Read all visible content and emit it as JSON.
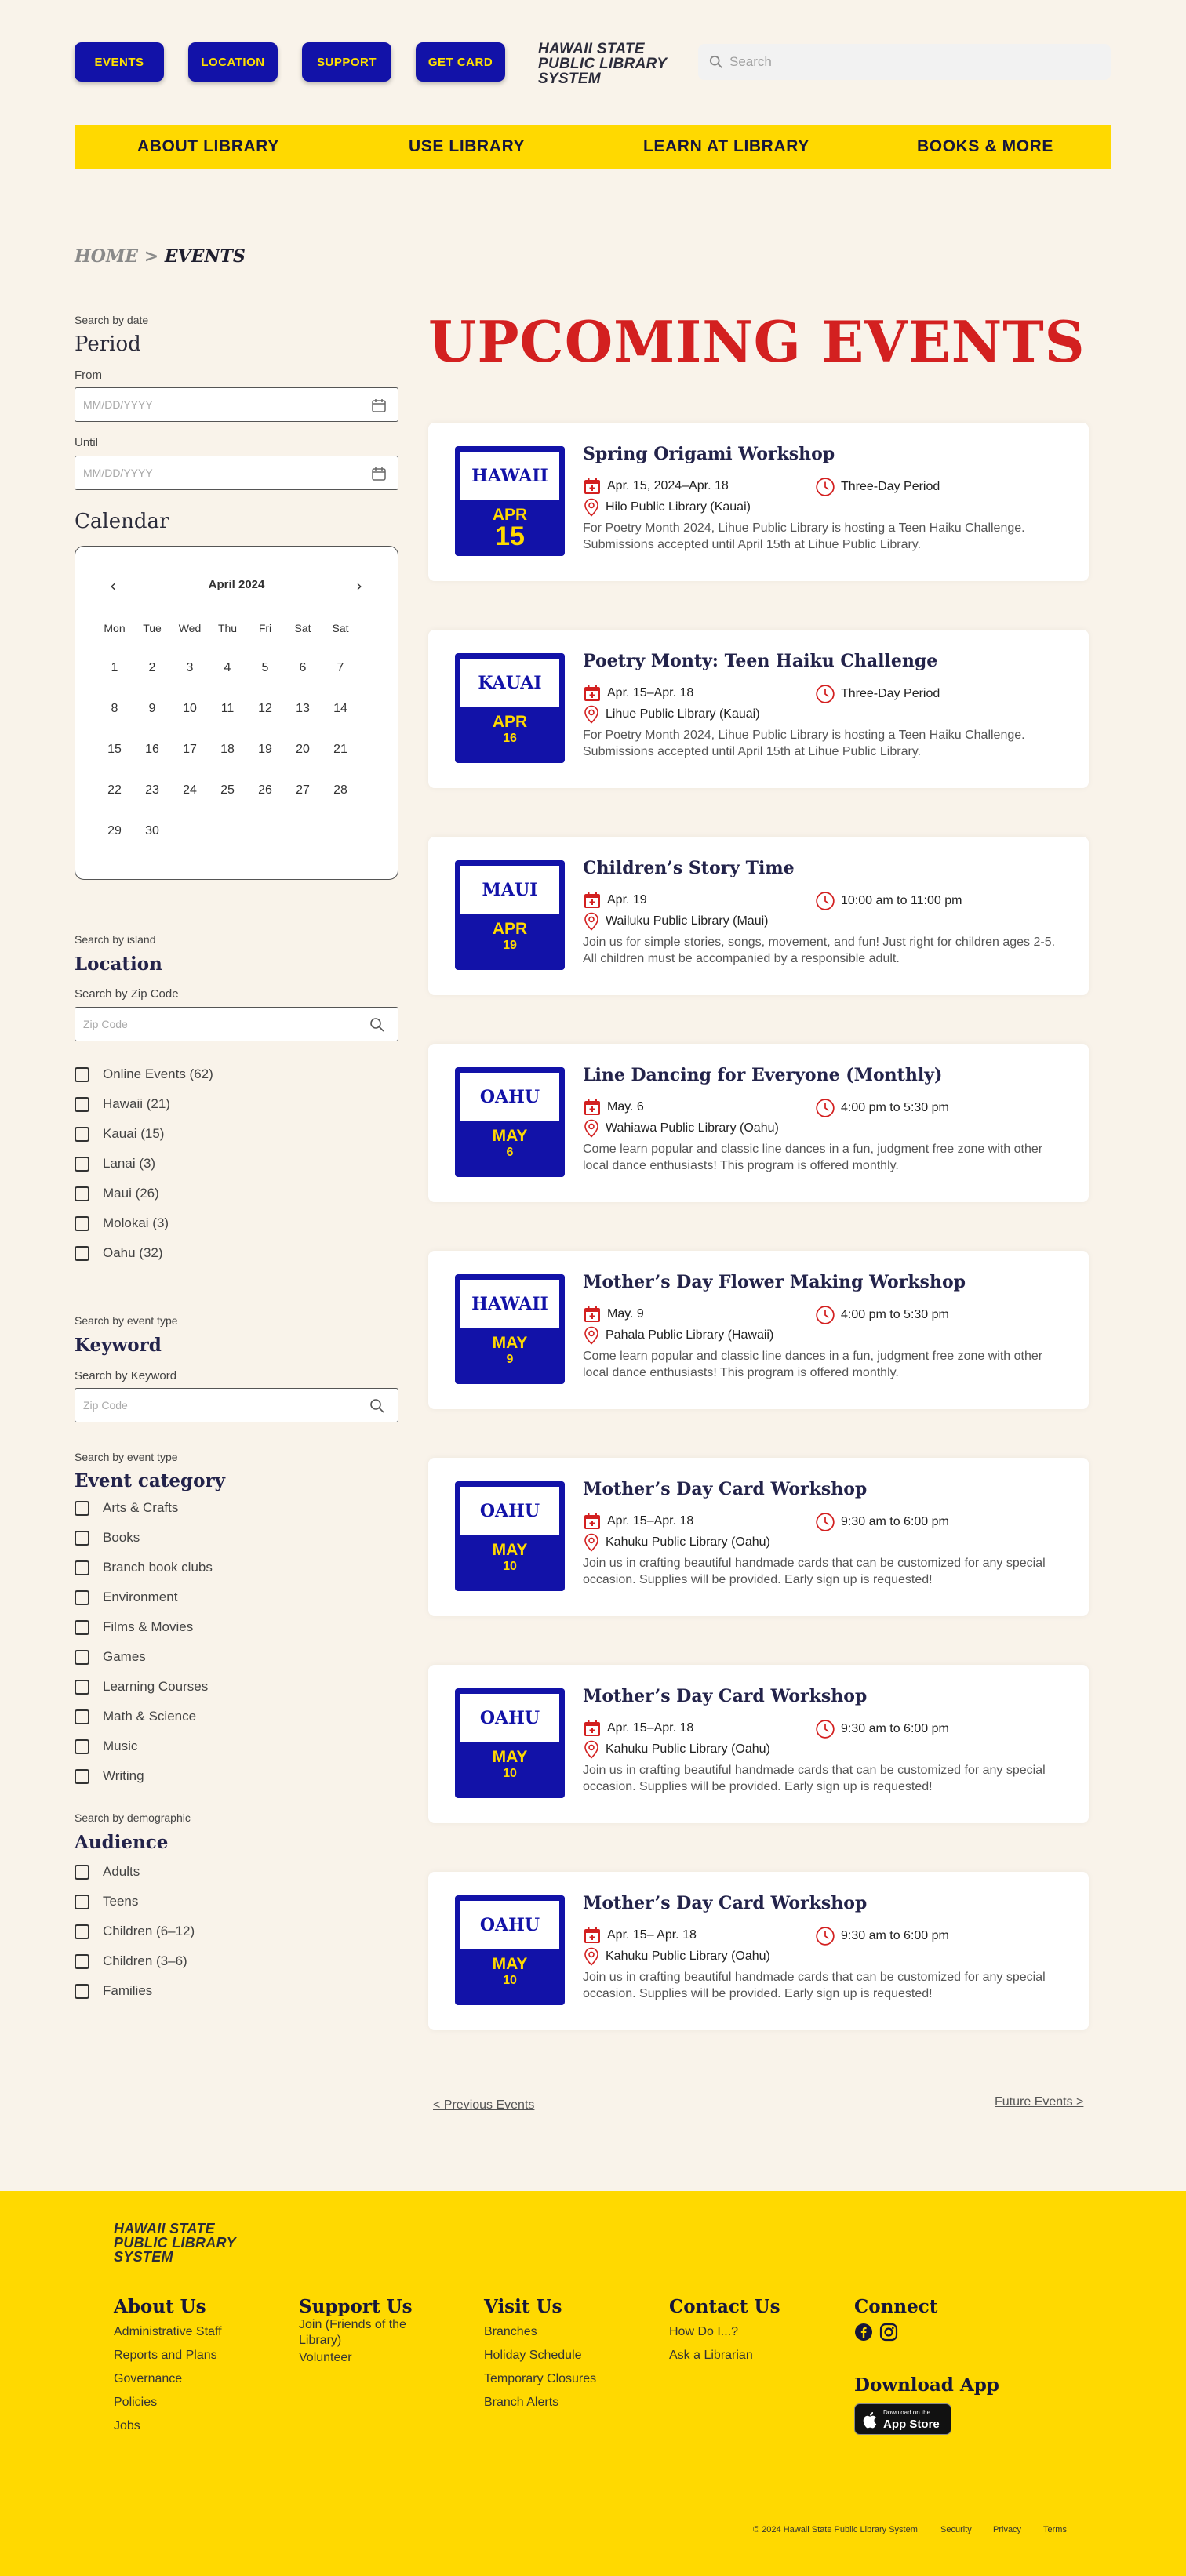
{
  "top_buttons": [
    "EVENTS",
    "LOCATION",
    "SUPPORT",
    "GET CARD"
  ],
  "logo": {
    "line1": "HAWAII STATE",
    "line2": "PUBLIC LIBRARY",
    "line3": "SYSTEM"
  },
  "search": {
    "placeholder": "Search"
  },
  "nav": [
    "ABOUT LIBRARY",
    "USE LIBRARY",
    "LEARN AT LIBRARY",
    "BOOKS & MORE"
  ],
  "breadcrumb": {
    "home": "HOME",
    "sep": " > ",
    "current": "EVENTS"
  },
  "sidebar": {
    "date": {
      "eyebrow": "Search by date",
      "heading": "Period",
      "from_label": "From",
      "until_label": "Until",
      "placeholder": "MM/DD/YYYY"
    },
    "calendar": {
      "heading": "Calendar",
      "month": "April 2024",
      "dow": [
        "Mon",
        "Tue",
        "Wed",
        "Thu",
        "Fri",
        "Sat",
        "Sat"
      ],
      "weeks": [
        [
          "1",
          "2",
          "3",
          "4",
          "5",
          "6",
          "7"
        ],
        [
          "8",
          "9",
          "10",
          "11",
          "12",
          "13",
          "14"
        ],
        [
          "15",
          "16",
          "17",
          "18",
          "19",
          "20",
          "21"
        ],
        [
          "22",
          "23",
          "24",
          "25",
          "26",
          "27",
          "28"
        ],
        [
          "29",
          "30"
        ]
      ]
    },
    "location": {
      "eyebrow": "Search by island",
      "heading": "Location",
      "zip_label": "Search by Zip Code",
      "zip_placeholder": "Zip Code",
      "options": [
        "Online Events (62)",
        "Hawaii (21)",
        "Kauai (15)",
        "Lanai (3)",
        "Maui (26)",
        "Molokai (3)",
        "Oahu (32)"
      ]
    },
    "keyword": {
      "eyebrow": "Search by event type",
      "heading": "Keyword",
      "label": "Search by Keyword",
      "placeholder": "Zip Code"
    },
    "category": {
      "eyebrow": "Search by event type",
      "heading": "Event category",
      "options": [
        "Arts & Crafts",
        "Books",
        "Branch book clubs",
        "Environment",
        "Films & Movies",
        "Games",
        "Learning Courses",
        "Math & Science",
        "Music",
        "Writing"
      ]
    },
    "audience": {
      "eyebrow": "Search by demographic",
      "heading": "Audience",
      "options": [
        "Adults",
        "Teens",
        "Children (6–12)",
        "Children (3–6)",
        "Families"
      ]
    }
  },
  "main": {
    "heading": "UPCOMING EVENTS",
    "events": [
      {
        "island": "HAWAII",
        "month": "APR",
        "day": "15",
        "title": "Spring Origami Workshop",
        "date": "Apr. 15, 2024–Apr. 18",
        "time": "Three-Day Period",
        "location": "Hilo Public Library (Kauai)",
        "desc": "For Poetry Month 2024, Lihue Public Library is hosting a Teen Haiku Challenge. Submissions accepted until April 15th at Lihue Public Library."
      },
      {
        "island": "KAUAI",
        "month": "APR",
        "day": "16",
        "title": "Poetry Monty: Teen Haiku Challenge",
        "date": "Apr. 15–Apr. 18",
        "time": "Three-Day Period",
        "location": "Lihue Public Library (Kauai)",
        "desc": "For Poetry Month 2024, Lihue Public Library is hosting a Teen Haiku Challenge. Submissions accepted until April 15th at Lihue Public Library."
      },
      {
        "island": "MAUI",
        "month": "APR",
        "day": "19",
        "title": "Children’s Story Time",
        "date": "Apr. 19",
        "time": "10:00 am to 11:00 pm",
        "location": "Wailuku Public Library (Maui)",
        "desc": "Join us for simple stories, songs, movement, and fun!  Just right for children ages 2-5. All children must be accompanied by a responsible adult."
      },
      {
        "island": "OAHU",
        "month": "MAY",
        "day": "6",
        "title": "Line Dancing for Everyone (Monthly)",
        "date": "May. 6",
        "time": "4:00 pm to 5:30 pm",
        "location": "Wahiawa Public Library (Oahu)",
        "desc": "Come learn popular and classic line dances in a fun, judgment free zone with other local dance enthusiasts! This program is offered monthly."
      },
      {
        "island": "HAWAII",
        "month": "MAY",
        "day": "9",
        "title": "Mother’s Day Flower Making Workshop",
        "date": "May. 9",
        "time": "4:00 pm to 5:30 pm",
        "location": "Pahala Public Library (Hawaii)",
        "desc": "Come learn popular and classic line dances in a fun, judgment free zone with other local dance enthusiasts! This program is offered monthly."
      },
      {
        "island": "OAHU",
        "month": "MAY",
        "day": "10",
        "title": "Mother’s Day Card Workshop",
        "date": "Apr. 15–Apr. 18",
        "time": "9:30 am to 6:00 pm",
        "location": "Kahuku Public Library (Oahu)",
        "desc": "Join us in crafting beautiful handmade cards that can be customized for any special occasion. Supplies will be provided. Early sign up is requested!"
      },
      {
        "island": "OAHU",
        "month": "MAY",
        "day": "10",
        "title": "Mother’s Day Card Workshop",
        "date": "Apr. 15–Apr. 18",
        "time": "9:30 am to 6:00 pm",
        "location": "Kahuku Public Library (Oahu)",
        "desc": "Join us in crafting beautiful handmade cards that can be customized for any special occasion. Supplies will be provided. Early sign up is requested!"
      },
      {
        "island": "OAHU",
        "month": "MAY",
        "day": "10",
        "title": "Mother’s Day Card Workshop",
        "date": "Apr. 15– Apr. 18",
        "time": "9:30 am to 6:00 pm",
        "location": "Kahuku Public Library (Oahu)",
        "desc": "Join us in crafting beautiful handmade cards that can be customized for any special occasion. Supplies will be provided. Early sign up is requested!"
      }
    ],
    "prev": "< Previous Events",
    "next": "Future Events >"
  },
  "footer": {
    "logo": {
      "line1": "HAWAII STATE",
      "line2": "PUBLIC LIBRARY",
      "line3": "SYSTEM"
    },
    "about": {
      "heading": "About Us",
      "links": [
        "Administrative Staff",
        "Reports and Plans",
        "Governance",
        "Policies",
        "Jobs"
      ]
    },
    "support": {
      "heading": "Support Us",
      "links": [
        "Join (Friends of the Library)",
        "Volunteer"
      ]
    },
    "visit": {
      "heading": "Visit Us",
      "links": [
        "Branches",
        "Holiday Schedule",
        "Temporary Closures",
        "Branch Alerts"
      ]
    },
    "contact": {
      "heading": "Contact Us",
      "links": [
        "How Do I...?",
        "Ask a Librarian"
      ]
    },
    "connect": {
      "heading": "Connect",
      "icons": [
        "facebook-icon",
        "instagram-icon"
      ]
    },
    "app": {
      "heading": "Download App",
      "badge_small": "Download on the",
      "badge_big": "App Store"
    },
    "legal": {
      "copyright": "© 2024 Hawaii State Public Library System",
      "security": "Security",
      "privacy": "Privacy",
      "terms": "Terms"
    }
  },
  "colors": {
    "blue": "#1212A8",
    "yellow": "#FFD900",
    "red": "#D32020",
    "cream": "#F9F3EA",
    "navy": "#23234A"
  }
}
